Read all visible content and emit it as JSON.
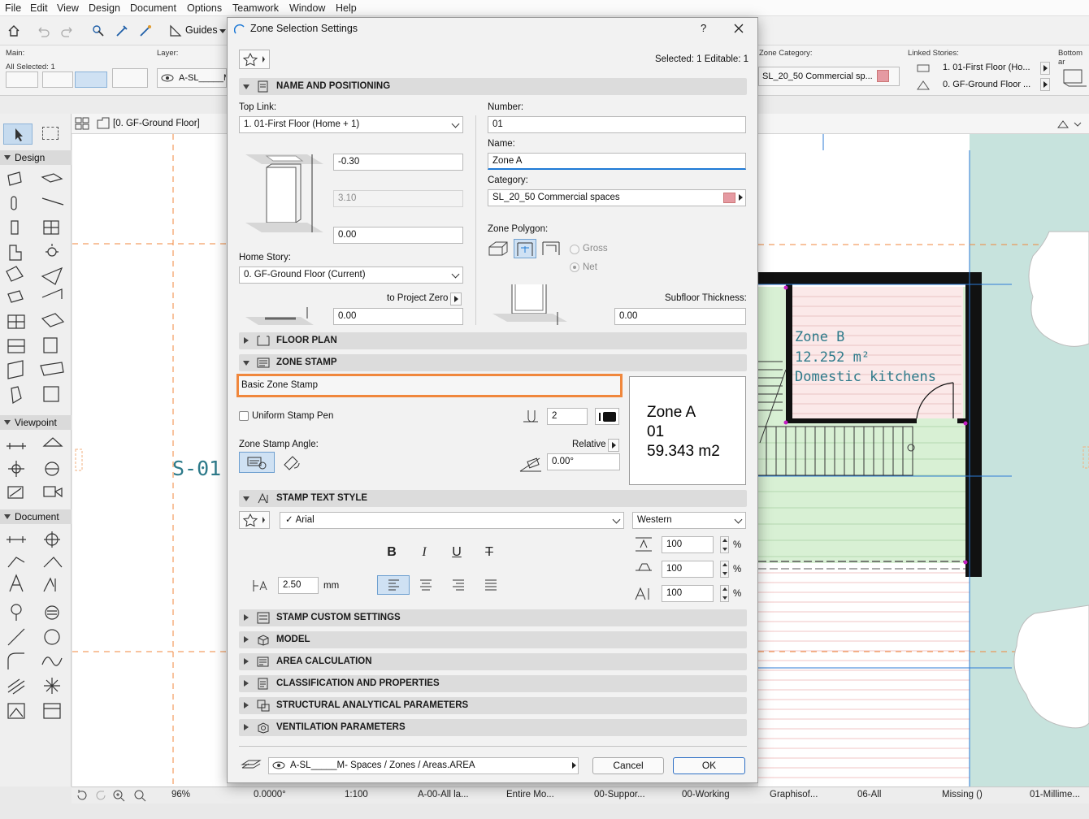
{
  "menu": [
    "File",
    "Edit",
    "View",
    "Design",
    "Document",
    "Options",
    "Teamwork",
    "Window",
    "Help"
  ],
  "toolbar": {
    "guides_label": "Guides"
  },
  "infobox": {
    "main_label": "Main:",
    "all_selected": "All Selected: 1",
    "layer_label": "Layer:",
    "layer_value": "A-SL_____M",
    "zone_category_label": "Zone Category:",
    "zone_category_value": "SL_20_50  Commercial sp...",
    "linked_stories_label": "Linked Stories:",
    "linked_top": "1. 01-First Floor (Ho...",
    "linked_home": "0. GF-Ground Floor ...",
    "bottom_label": "Bottom ar"
  },
  "tab": {
    "title": "[0. GF-Ground Floor]"
  },
  "toolbox": {
    "design": "Design",
    "viewpoint": "Viewpoint",
    "document": "Document"
  },
  "canvas": {
    "section_marker": "S-01",
    "zone_b_name": "Zone B",
    "zone_b_area": "12.252 m²",
    "zone_b_category": "Domestic kitchens"
  },
  "statusbar": {
    "zoom": "96%",
    "angle": "0.0000°",
    "scale": "1:100",
    "layer_combo": "A-00-All la...",
    "model_view": "Entire Mo...",
    "structure": "00-Suppor...",
    "graphic": "00-Working",
    "renovation": "Graphisof...",
    "story": "06-All",
    "missing": "Missing ()",
    "dimension": "01-Millime..."
  },
  "dialog": {
    "title": "Zone Selection Settings",
    "help": "?",
    "selected_info": "Selected: 1 Editable: 1",
    "sections": {
      "name_pos": "NAME AND POSITIONING",
      "floor_plan": "FLOOR PLAN",
      "zone_stamp": "ZONE STAMP",
      "stamp_text": "STAMP TEXT STYLE",
      "custom": "STAMP CUSTOM SETTINGS",
      "model": "MODEL",
      "area": "AREA CALCULATION",
      "class": "CLASSIFICATION AND PROPERTIES",
      "struct": "STRUCTURAL ANALYTICAL PARAMETERS",
      "vent": "VENTILATION PARAMETERS"
    },
    "name_pos": {
      "top_link_label": "Top Link:",
      "top_link_value": "1. 01-First Floor (Home + 1)",
      "top_offset": "-0.30",
      "height": "3.10",
      "bottom_offset": "0.00",
      "home_story_label": "Home Story:",
      "home_story_value": "0. GF-Ground Floor (Current)",
      "to_project_zero": "to Project Zero",
      "project_zero_value": "0.00",
      "number_label": "Number:",
      "number_value": "01",
      "name_label": "Name:",
      "name_value": "Zone A",
      "category_label": "Category:",
      "category_value": "SL_20_50  Commercial spaces",
      "zone_polygon_label": "Zone Polygon:",
      "gross": "Gross",
      "net": "Net",
      "subfloor_label": "Subfloor Thickness:",
      "subfloor_value": "0.00"
    },
    "zone_stamp": {
      "stamp_name": "Basic Zone Stamp",
      "uniform_pen": "Uniform Stamp Pen",
      "pen_value": "2",
      "angle_label": "Zone Stamp Angle:",
      "relative": "Relative",
      "angle_value": "0.00°",
      "preview_name": "Zone A",
      "preview_number": "01",
      "preview_area": "59.343 m2"
    },
    "text_style": {
      "font": "Arial",
      "script": "Western",
      "bold": "B",
      "italic": "I",
      "underline": "U",
      "strike": "T",
      "size": "2.50",
      "size_unit": "mm",
      "width_pct": "100",
      "slant_pct": "100",
      "spacing_pct": "100",
      "percent": "%"
    },
    "footer": {
      "layer": "A-SL_____M- Spaces / Zones / Areas.AREA",
      "cancel": "Cancel",
      "ok": "OK"
    }
  },
  "colors": {
    "category_swatch": "#e59aa2",
    "highlight": "#f0873c",
    "accent": "#1f7ad6",
    "zone_b_text": "#2d7a8a"
  }
}
